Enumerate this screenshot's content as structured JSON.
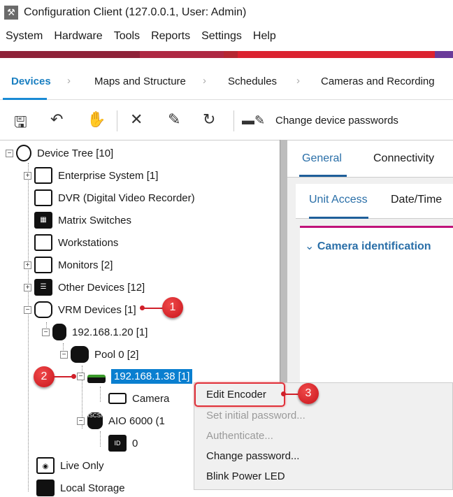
{
  "window": {
    "title": "Configuration Client (127.0.0.1, User: Admin)"
  },
  "menu": [
    "System",
    "Hardware",
    "Tools",
    "Reports",
    "Settings",
    "Help"
  ],
  "brand_colors": [
    "#8e2239",
    "#ae2843",
    "#b52832",
    "#db2230",
    "#6a3b9a"
  ],
  "nav_tabs": [
    {
      "label": "Devices",
      "active": true
    },
    {
      "label": "Maps and Structure"
    },
    {
      "label": "Schedules"
    },
    {
      "label": "Cameras and Recording"
    }
  ],
  "toolbar": {
    "save": "save",
    "undo": "undo",
    "hand": "hand",
    "delete": "delete",
    "edit": "edit",
    "refresh": "refresh",
    "change_passwords_label": "Change device passwords"
  },
  "tree": [
    {
      "label": "Device Tree [10]"
    },
    {
      "label": "Enterprise System [1]"
    },
    {
      "label": "DVR (Digital Video Recorder)"
    },
    {
      "label": "Matrix Switches"
    },
    {
      "label": "Workstations"
    },
    {
      "label": "Monitors [2]"
    },
    {
      "label": "Other Devices [12]"
    },
    {
      "label": "VRM Devices [1]"
    },
    {
      "label": "192.168.1.20 [1]"
    },
    {
      "label": "Pool 0 [2]"
    },
    {
      "label": "192.168.1.38 [1]",
      "selected": true
    },
    {
      "label": "Camera"
    },
    {
      "label": "AIO 6000 (1"
    },
    {
      "label": "0"
    },
    {
      "label": "Live Only"
    },
    {
      "label": "Local Storage"
    }
  ],
  "iscsi_label": "iSCSI",
  "id_label": "ID",
  "right_panel": {
    "tabs": [
      "General",
      "Connectivity"
    ],
    "subtabs": [
      "Unit Access",
      "Date/Time"
    ],
    "section": "Camera identification"
  },
  "context_menu": [
    {
      "label": "Edit Encoder",
      "enabled": true
    },
    {
      "label": "Set initial password...",
      "enabled": false
    },
    {
      "label": "Authenticate...",
      "enabled": false
    },
    {
      "label": "Change password...",
      "enabled": true
    },
    {
      "label": "Blink Power LED",
      "enabled": true
    }
  ],
  "callouts": [
    "1",
    "2",
    "3"
  ]
}
